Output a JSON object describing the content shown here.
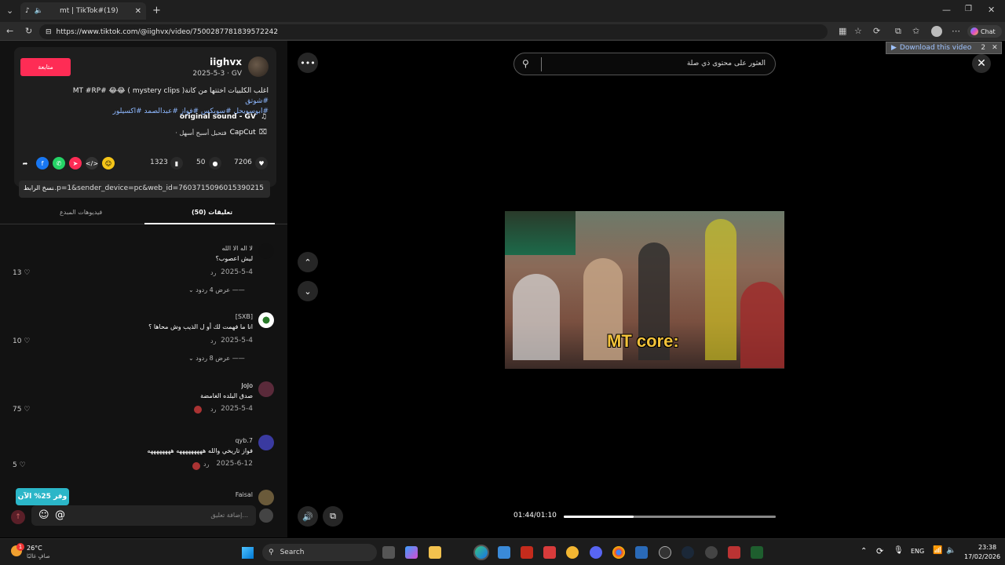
{
  "browser": {
    "tab_title": "mt | TikTok#(19)",
    "url": "https://www.tiktok.com/@iighvx/video/7500287781839572242",
    "chat_label": "Chat",
    "download_label": "Download this video",
    "download_count": "2"
  },
  "post": {
    "follow_label": "متابعة",
    "username": "iighvx",
    "date": "2025-5-3 · GV",
    "description": "اغلب الكلبيات اختتها من كانة( mystery clips ) 😂😂 #MT #RP",
    "tags_line1": "#شوتق",
    "tags_line2": "#ابوسويحل #سويكس #فواز #عبدالصمد #اكسيلور",
    "sound": "original sound - GV",
    "capcut_name": "CapCut",
    "capcut_text": "· فتحبل أسبح أسهل"
  },
  "stats": {
    "likes": "7206",
    "comments": "50",
    "saves": "1323"
  },
  "link": {
    "copy_label": "نسخ الرابط",
    "text": "...p=1&sender_device=pc&web_id=7603715096015390215"
  },
  "tabs": {
    "comments": "(50) تعليقات",
    "creator_videos": "فيديوهات المبدع"
  },
  "comments": [
    {
      "name": "لا اله الا الله",
      "text": "ليش اعصوب؟",
      "date": "2025-5-4",
      "reply": "رد",
      "likes": "13",
      "more": "عرض 4 ردود"
    },
    {
      "name": "[SXB]",
      "text": "انا ما فهمت لك أو ل الذيب وش محاها ؟",
      "date": "2025-5-4",
      "reply": "رد",
      "likes": "10",
      "more": "عرض 8 ردود"
    },
    {
      "name": "JoJo",
      "text": "صدق البلده الغامضة",
      "date": "2025-5-4",
      "reply": "رد",
      "likes": "75",
      "more": ""
    },
    {
      "name": "qyb.7",
      "text": "فواز تاريخي والله هههههههههه ههههههههه",
      "date": "2025-6-12",
      "reply": "رد",
      "likes": "5",
      "more": ""
    },
    {
      "name": "Faisal",
      "text": "",
      "date": "",
      "reply": "",
      "likes": "",
      "more": ""
    }
  ],
  "save_badge": "وفر 25% الآن",
  "add_comment_placeholder": "إضافة تعليق...",
  "search_placeholder": "العثور على محتوى ذي صلة",
  "video": {
    "caption": "MT core:",
    "time": "01:44/01:10",
    "progress": 0.33
  },
  "taskbar": {
    "weather_temp": "26°C",
    "weather_desc": "صافٍ غالبًا",
    "search_label": "Search",
    "language": "ENG",
    "time": "23:38",
    "date": "17/02/2026",
    "notification_count": "1"
  }
}
